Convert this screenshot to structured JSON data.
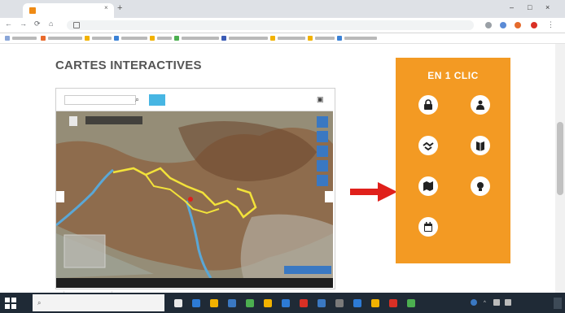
{
  "browser": {
    "tab_title": "",
    "tab_close": "×",
    "new_tab": "+",
    "url": "",
    "window_controls": [
      "–",
      "□",
      "×"
    ],
    "nav": [
      "←",
      "→",
      "⟳",
      "⌂"
    ],
    "bookmarks_count_visible": 9
  },
  "page": {
    "title": "CARTES INTERACTIVES",
    "subtitle": ""
  },
  "map": {
    "search_placeholder": "",
    "search_icon": "search-icon",
    "menu_icon": "menu-icon",
    "zoom_label": "",
    "coords": "",
    "tab_label": "",
    "controls": [
      "zoom-in-icon",
      "zoom-out-icon",
      "layers-icon",
      "fullscreen-icon",
      "measure-icon"
    ]
  },
  "clic": {
    "title": "EN 1 CLIC",
    "buttons": [
      {
        "icon": "padlock-icon",
        "label": ""
      },
      {
        "icon": "person-icon",
        "label": ""
      },
      {
        "icon": "handshake-icon",
        "label": ""
      },
      {
        "icon": "book-icon",
        "label": ""
      },
      {
        "icon": "map-icon",
        "label": ""
      },
      {
        "icon": "lightbulb-icon",
        "label": ""
      },
      {
        "icon": "calendar-icon",
        "label": ""
      }
    ]
  },
  "taskbar": {
    "search_placeholder": "",
    "clock": ""
  },
  "colors": {
    "accent_orange": "#f39a23",
    "arrow_red": "#e0201b",
    "map_route_yellow": "#f2e23a",
    "river_blue": "#5aa7d6",
    "map_filter_blue": "#47b6e3"
  }
}
